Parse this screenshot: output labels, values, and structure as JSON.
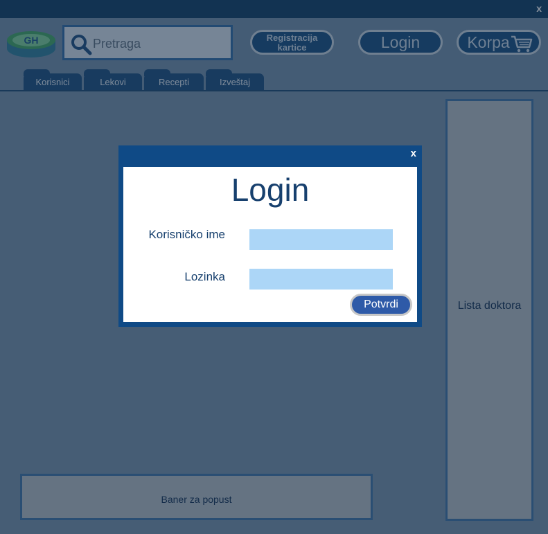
{
  "window": {
    "close_label": "x"
  },
  "header": {
    "search": {
      "placeholder": "Pretraga"
    },
    "buttons": {
      "registration_line1": "Registracija",
      "registration_line2": "kartice",
      "login": "Login",
      "cart": "Korpa"
    },
    "tabs": [
      {
        "label": "Korisnici"
      },
      {
        "label": "Lekovi"
      },
      {
        "label": "Recepti"
      },
      {
        "label": "Izveštaj"
      }
    ]
  },
  "main": {
    "sidebar_label": "Lista doktora",
    "banner_label": "Baner za popust"
  },
  "dialog": {
    "close_label": "x",
    "title": "Login",
    "username_label": "Korisničko ime",
    "password_label": "Lozinka",
    "submit_label": "Potvrdi"
  },
  "colors": {
    "titlebar": "#0f3e66",
    "accent": "#174f82",
    "dialog_frame": "#0f4a86",
    "input_fill": "#acd6f7",
    "button": "#2e5aa8"
  },
  "icons": {
    "search": "search-icon",
    "cart": "cart-icon",
    "logo": "pharmacy-logo"
  }
}
